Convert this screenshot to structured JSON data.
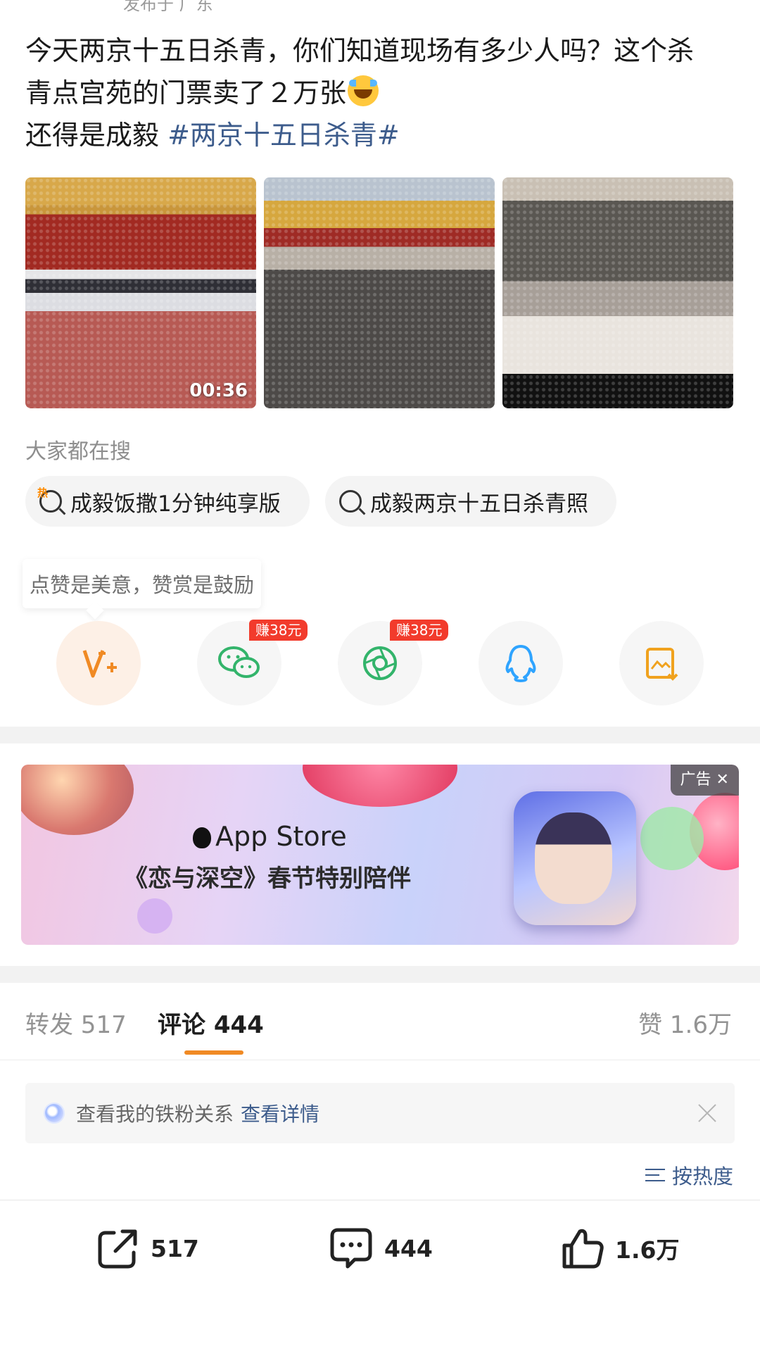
{
  "top_cut_text": "发布于 广东",
  "post": {
    "line1": "今天两京十五日杀青，你们知道现场有多少人吗？这个杀",
    "line2": "青点宫苑的门票卖了２万张",
    "line3_prefix": "还得是成毅 ",
    "hashtag": "#两京十五日杀青#",
    "emoji": "laughing-crying-emoji"
  },
  "media": {
    "video_duration": "00:36"
  },
  "search": {
    "title": "大家都在搜",
    "items": [
      {
        "label": "成毅饭撒1分钟纯享版",
        "hot_tag": "热"
      },
      {
        "label": "成毅两京十五日杀青照"
      }
    ]
  },
  "reward": {
    "tip": "点赞是美意，赞赏是鼓励"
  },
  "share": {
    "targets": [
      "reward-v-plus-icon",
      "wechat-icon",
      "moments-icon",
      "qq-icon",
      "save-image-icon"
    ],
    "earn_badge_1": "赚38元",
    "earn_badge_2": "赚38元"
  },
  "ad": {
    "store_name": "App Store",
    "text": "《恋与深空》春节特别陪伴",
    "label": "广告"
  },
  "tabs": {
    "repost": "转发 517",
    "comment": "评论 444",
    "like": "赞 1.6万"
  },
  "fan_bar": {
    "text": "查看我的铁粉关系",
    "link": "查看详情"
  },
  "sort": {
    "label": "按热度"
  },
  "bottom_bar": {
    "repost_count": "517",
    "comment_count": "444",
    "like_count": "1.6万"
  },
  "colors": {
    "link_blue": "#3d5c8c",
    "accent_orange": "#f08a24",
    "badge_red": "#f23b2c"
  }
}
